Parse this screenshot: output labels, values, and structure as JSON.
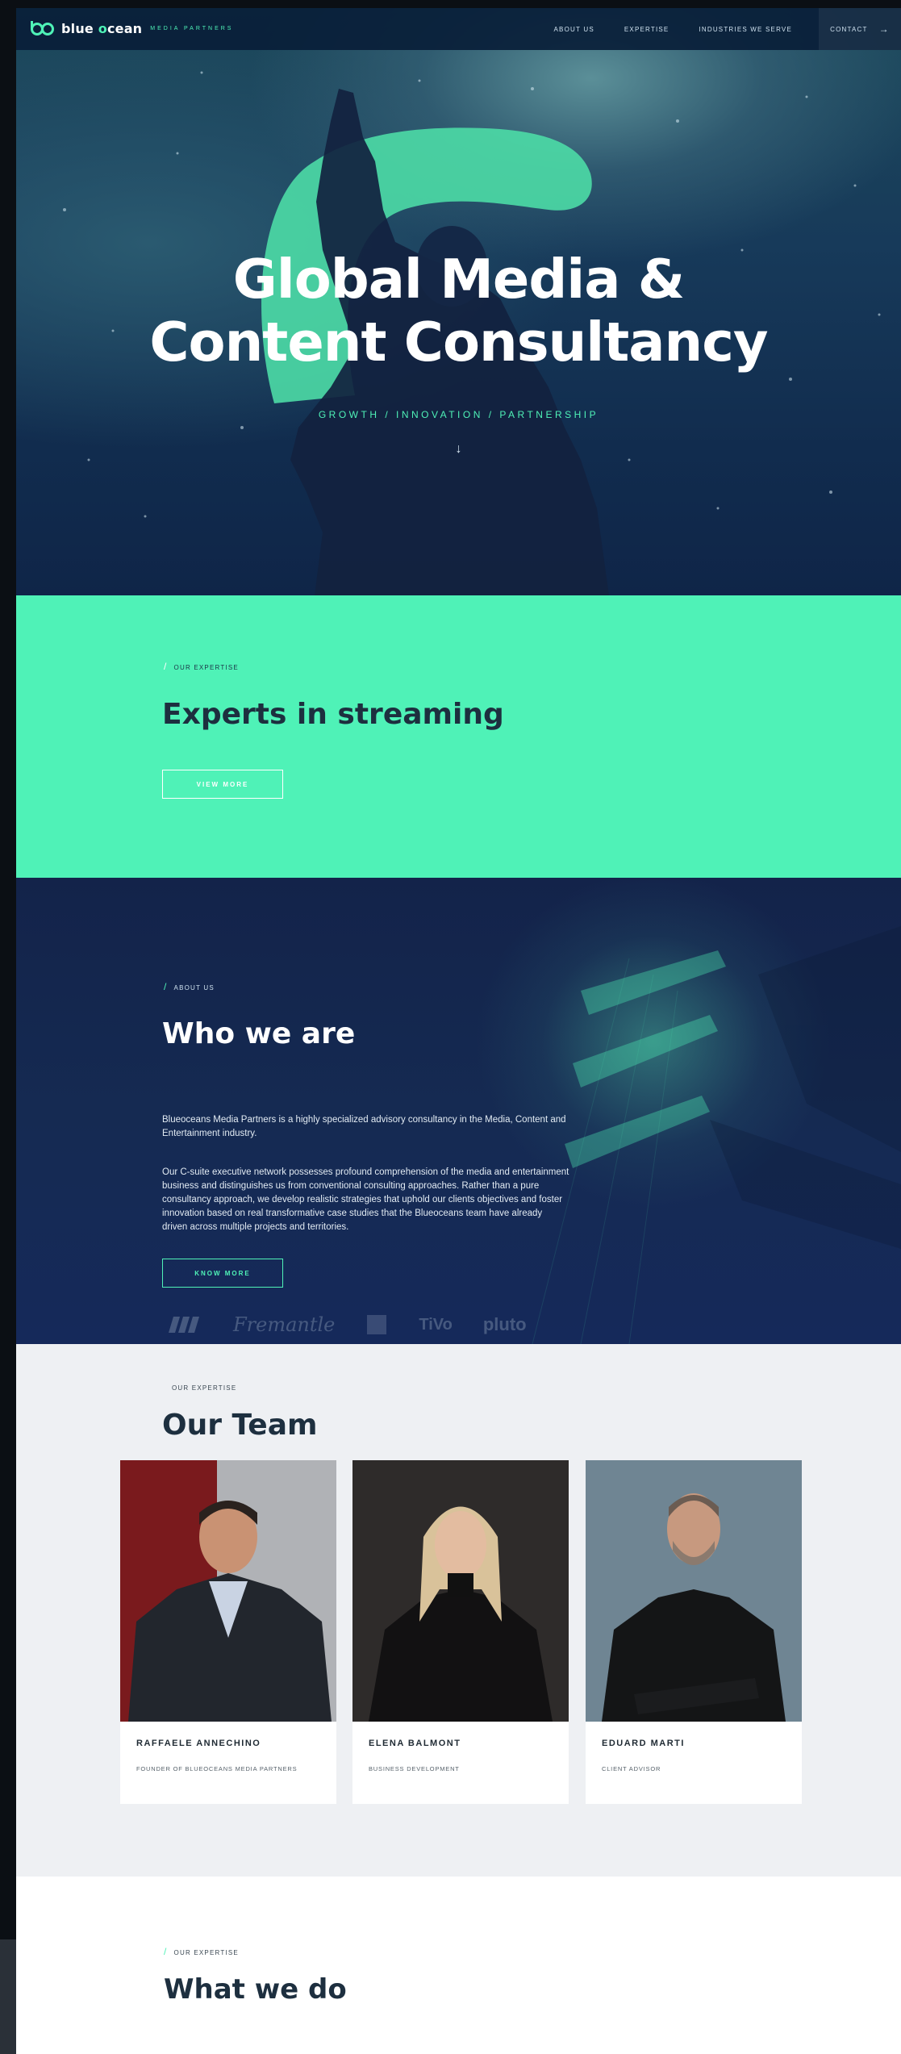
{
  "brand": {
    "name_prefix": "blue ",
    "name_o": "o",
    "name_suffix": "cean",
    "subtitle": "MEDIA PARTNERS",
    "accent": "#4ff2b7",
    "navy": "#13234a"
  },
  "nav": {
    "links": [
      "ABOUT US",
      "EXPERTISE",
      "INDUSTRIES WE SERVE"
    ],
    "contact": "CONTACT",
    "contact_arrow": "→"
  },
  "hero": {
    "title_line1": "Global Media &",
    "title_line2": "Content Consultancy",
    "tagline": "GROWTH / INNOVATION / PARTNERSHIP",
    "scroll_icon": "arrow-down-icon",
    "scroll_glyph": "↓"
  },
  "expertise": {
    "slash": "/",
    "eyebrow": "OUR EXPERTISE",
    "title": "Experts in  streaming",
    "button": "VIEW MORE"
  },
  "about": {
    "slash": "/",
    "eyebrow": "ABOUT US",
    "title": "Who we are",
    "paragraph1": "Blueoceans Media Partners is a highly specialized advisory consultancy in the Media, Content and Entertainment industry.",
    "paragraph2": "Our C-suite executive network possesses profound comprehension of the media and entertainment business and distinguishes us from conventional consulting approaches. Rather than a pure consultancy approach, we develop realistic strategies that uphold our clients objectives and foster innovation based on real transformative case studies that the Blueoceans team have already driven across multiple projects and territories.",
    "button": "KNOW MORE",
    "partner_logos": [
      "atresmedia",
      "Fremantle",
      "dazn",
      "TiVo",
      "pluto"
    ],
    "partner_logo_text": [
      "",
      "Fremantle",
      "",
      "TiVo",
      "pluto"
    ]
  },
  "team": {
    "eyebrow": "OUR EXPERTISE",
    "title": "Our Team",
    "members": [
      {
        "name": "RAFFAELE ANNECHINO",
        "role": "FOUNDER OF BLUEOCEANS MEDIA PARTNERS"
      },
      {
        "name": "ELENA BALMONT",
        "role": "BUSINESS DEVELOPMENT"
      },
      {
        "name": "EDUARD MARTI",
        "role": "CLIENT ADVISOR"
      }
    ]
  },
  "what_we_do": {
    "slash": "/",
    "eyebrow": "OUR EXPERTISE",
    "title": "What we do"
  }
}
